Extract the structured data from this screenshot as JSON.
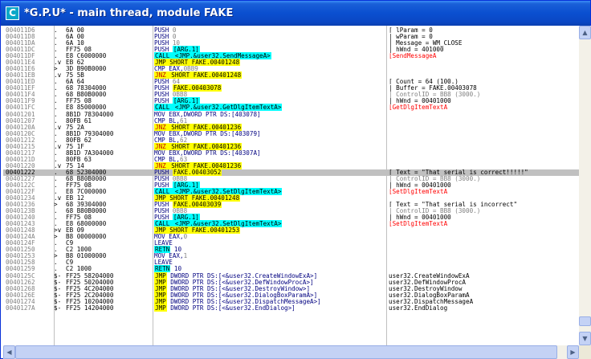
{
  "window": {
    "title": "*G.P.U* - main thread, module FAKE",
    "icon_letter": "C"
  },
  "rows": [
    {
      "addr": "004011D6",
      "jmark": ".",
      "hex": "6A 00",
      "dis": [
        {
          "t": "PUSH "
        },
        {
          "t": "0",
          "k": "gray"
        }
      ],
      "com": [
        {
          "t": "⌈ lParam = 0"
        }
      ]
    },
    {
      "addr": "004011D8",
      "jmark": ".",
      "hex": "6A 00",
      "dis": [
        {
          "t": "PUSH "
        },
        {
          "t": "0",
          "k": "gray"
        }
      ],
      "com": [
        {
          "t": "| wParam = 0"
        }
      ]
    },
    {
      "addr": "004011DA",
      "jmark": ".",
      "hex": "6A 10",
      "dis": [
        {
          "t": "PUSH "
        },
        {
          "t": "10",
          "k": "gray"
        }
      ],
      "com": [
        {
          "t": "| Message = WM_CLOSE"
        }
      ]
    },
    {
      "addr": "004011DC",
      "jmark": ".",
      "hex": "FF75 08",
      "dis": [
        {
          "t": "PUSH "
        },
        {
          "t": "[ARG.1]",
          "k": "arg"
        }
      ],
      "com": [
        {
          "t": "| hWnd = 401000"
        }
      ]
    },
    {
      "addr": "004011DF",
      "jmark": ".",
      "hex": "E8 C6000000",
      "dis": [
        {
          "t": "CALL",
          "k": "call"
        },
        {
          "t": " <JMP.&user32.SendMessageA>",
          "k": "call"
        }
      ],
      "com": [
        {
          "t": "⌊SendMessageA",
          "k": "red"
        }
      ]
    },
    {
      "addr": "004011E4",
      "jmark": ".v",
      "hex": "EB 62",
      "dis": [
        {
          "t": "JMP SHORT FAKE.00401248",
          "k": "jmp"
        }
      ],
      "com": []
    },
    {
      "addr": "004011E6",
      "jmark": ">",
      "hex": "3D B90B0000",
      "dis": [
        {
          "t": "CMP EAX,"
        },
        {
          "t": "0BB9",
          "k": "gray"
        }
      ],
      "com": []
    },
    {
      "addr": "004011EB",
      "jmark": ".v",
      "hex": "75 5B",
      "dis": [
        {
          "t": "JNZ",
          "k": "jcc"
        },
        {
          "t": " SHORT FAKE.00401248",
          "k": "jmp"
        }
      ],
      "com": []
    },
    {
      "addr": "004011ED",
      "jmark": ".",
      "hex": "6A 64",
      "dis": [
        {
          "t": "PUSH "
        },
        {
          "t": "64",
          "k": "gray"
        }
      ],
      "com": [
        {
          "t": "⌈ Count = 64 (100.)"
        }
      ]
    },
    {
      "addr": "004011EF",
      "jmark": ".",
      "hex": "68 78304000",
      "dis": [
        {
          "t": "PUSH "
        },
        {
          "t": "FAKE.00403078",
          "k": "jmp"
        }
      ],
      "com": [
        {
          "t": "| Buffer = FAKE.00403078"
        }
      ]
    },
    {
      "addr": "004011F4",
      "jmark": ".",
      "hex": "68 B80B0000",
      "dis": [
        {
          "t": "PUSH "
        },
        {
          "t": "0BB8",
          "k": "gray"
        }
      ],
      "com": [
        {
          "t": "| ControlID = BB8 (3000.)",
          "k": "gray"
        }
      ]
    },
    {
      "addr": "004011F9",
      "jmark": ".",
      "hex": "FF75 08",
      "dis": [
        {
          "t": "PUSH "
        },
        {
          "t": "[ARG.1]",
          "k": "arg"
        }
      ],
      "com": [
        {
          "t": "| hWnd = 00401000"
        }
      ]
    },
    {
      "addr": "004011FC",
      "jmark": ".",
      "hex": "E8 85000000",
      "dis": [
        {
          "t": "CALL",
          "k": "call"
        },
        {
          "t": " <JMP.&user32.GetDlgItemTextA>",
          "k": "call"
        }
      ],
      "com": [
        {
          "t": "⌊GetDlgItemTextA",
          "k": "red"
        }
      ]
    },
    {
      "addr": "00401201",
      "jmark": ".",
      "hex": "8B1D 78304000",
      "dis": [
        {
          "t": "MOV EBX,DWORD PTR DS:[403078]"
        }
      ],
      "com": []
    },
    {
      "addr": "00401207",
      "jmark": ".",
      "hex": "80FB 61",
      "dis": [
        {
          "t": "CMP BL,"
        },
        {
          "t": "61",
          "k": "gray"
        }
      ],
      "com": []
    },
    {
      "addr": "0040120A",
      "jmark": ".v",
      "hex": "75 2A",
      "dis": [
        {
          "t": "JNZ",
          "k": "jcc"
        },
        {
          "t": " SHORT FAKE.00401236",
          "k": "jmp"
        }
      ],
      "com": []
    },
    {
      "addr": "0040120C",
      "jmark": ".",
      "hex": "8B1D 79304000",
      "dis": [
        {
          "t": "MOV EBX,DWORD PTR DS:[403079]"
        }
      ],
      "com": []
    },
    {
      "addr": "00401212",
      "jmark": ".",
      "hex": "80FB 62",
      "dis": [
        {
          "t": "CMP BL,"
        },
        {
          "t": "62",
          "k": "gray"
        }
      ],
      "com": []
    },
    {
      "addr": "00401215",
      "jmark": ".v",
      "hex": "75 1F",
      "dis": [
        {
          "t": "JNZ",
          "k": "jcc"
        },
        {
          "t": " SHORT FAKE.00401236",
          "k": "jmp"
        }
      ],
      "com": []
    },
    {
      "addr": "00401217",
      "jmark": ".",
      "hex": "8B1D 7A304000",
      "dis": [
        {
          "t": "MOV EBX,DWORD PTR DS:[40307A]"
        }
      ],
      "com": []
    },
    {
      "addr": "0040121D",
      "jmark": ".",
      "hex": "80FB 63",
      "dis": [
        {
          "t": "CMP BL,"
        },
        {
          "t": "63",
          "k": "gray"
        }
      ],
      "com": []
    },
    {
      "addr": "00401220",
      "jmark": ".v",
      "hex": "75 14",
      "dis": [
        {
          "t": "JNZ",
          "k": "jcc"
        },
        {
          "t": " SHORT FAKE.00401236",
          "k": "jmp"
        }
      ],
      "com": []
    },
    {
      "addr": "00401222",
      "jmark": ".",
      "hex": "68 52304000",
      "dis": [
        {
          "t": "PUSH "
        },
        {
          "t": "FAKE.00403052",
          "k": "jmp"
        }
      ],
      "com": [
        {
          "t": "⌈ Text = \"That serial is correct!!!!!\""
        }
      ],
      "sel": true
    },
    {
      "addr": "00401227",
      "jmark": ".",
      "hex": "68 B80B0000",
      "dis": [
        {
          "t": "PUSH "
        },
        {
          "t": "0BB8",
          "k": "gray"
        }
      ],
      "com": [
        {
          "t": "| ControlID = BB8 (3000.)",
          "k": "gray"
        }
      ]
    },
    {
      "addr": "0040122C",
      "jmark": ".",
      "hex": "FF75 08",
      "dis": [
        {
          "t": "PUSH "
        },
        {
          "t": "[ARG.1]",
          "k": "arg"
        }
      ],
      "com": [
        {
          "t": "| hWnd = 00401000"
        }
      ]
    },
    {
      "addr": "0040122F",
      "jmark": ".",
      "hex": "E8 7C000000",
      "dis": [
        {
          "t": "CALL",
          "k": "call"
        },
        {
          "t": " <JMP.&user32.SetDlgItemTextA>",
          "k": "call"
        }
      ],
      "com": [
        {
          "t": "⌊SetDlgItemTextA",
          "k": "red"
        }
      ]
    },
    {
      "addr": "00401234",
      "jmark": ".v",
      "hex": "EB 12",
      "dis": [
        {
          "t": "JMP SHORT FAKE.00401248",
          "k": "jmp"
        }
      ],
      "com": []
    },
    {
      "addr": "00401236",
      "jmark": ">",
      "hex": "68 39304000",
      "dis": [
        {
          "t": "PUSH "
        },
        {
          "t": "FAKE.00403039",
          "k": "jmp"
        }
      ],
      "com": [
        {
          "t": "⌈ Text = \"That serial is incorrect\""
        }
      ]
    },
    {
      "addr": "0040123B",
      "jmark": ".",
      "hex": "68 B80B0000",
      "dis": [
        {
          "t": "PUSH "
        },
        {
          "t": "0BB8",
          "k": "gray"
        }
      ],
      "com": [
        {
          "t": "| ControlID = BB8 (3000.)",
          "k": "gray"
        }
      ]
    },
    {
      "addr": "00401240",
      "jmark": ".",
      "hex": "FF75 08",
      "dis": [
        {
          "t": "PUSH "
        },
        {
          "t": "[ARG.1]",
          "k": "arg"
        }
      ],
      "com": [
        {
          "t": "| hWnd = 00401000"
        }
      ]
    },
    {
      "addr": "00401243",
      "jmark": ".",
      "hex": "E8 68000000",
      "dis": [
        {
          "t": "CALL",
          "k": "call"
        },
        {
          "t": " <JMP.&user32.SetDlgItemTextA>",
          "k": "call"
        }
      ],
      "com": [
        {
          "t": "⌊SetDlgItemTextA",
          "k": "red"
        }
      ]
    },
    {
      "addr": "00401248",
      "jmark": ">v",
      "hex": "EB 09",
      "dis": [
        {
          "t": "JMP SHORT FAKE.00401253",
          "k": "jmp"
        }
      ],
      "com": []
    },
    {
      "addr": "0040124A",
      "jmark": ">",
      "hex": "B8 00000000",
      "dis": [
        {
          "t": "MOV EAX,"
        },
        {
          "t": "0",
          "k": "gray"
        }
      ],
      "com": []
    },
    {
      "addr": "0040124F",
      "jmark": ".",
      "hex": "C9",
      "dis": [
        {
          "t": "LEAVE"
        }
      ],
      "com": []
    },
    {
      "addr": "00401250",
      "jmark": ".",
      "hex": "C2 1000",
      "dis": [
        {
          "t": "RETN",
          "k": "retn"
        },
        {
          "t": " 10"
        }
      ],
      "com": []
    },
    {
      "addr": "00401253",
      "jmark": ">",
      "hex": "B8 01000000",
      "dis": [
        {
          "t": "MOV EAX,"
        },
        {
          "t": "1",
          "k": "gray"
        }
      ],
      "com": []
    },
    {
      "addr": "00401258",
      "jmark": ".",
      "hex": "C9",
      "dis": [
        {
          "t": "LEAVE"
        }
      ],
      "com": []
    },
    {
      "addr": "00401259",
      "jmark": ".",
      "hex": "C2 1000",
      "dis": [
        {
          "t": "RETN",
          "k": "retn"
        },
        {
          "t": " 10"
        }
      ],
      "com": []
    },
    {
      "addr": "0040125C",
      "jmark": "$-",
      "hex": "FF25 58204000",
      "dis": [
        {
          "t": "JMP",
          "k": "jmp"
        },
        {
          "t": " DWORD PTR DS:[<&user32.CreateWindowExA>]"
        }
      ],
      "com": [
        {
          "t": "user32.CreateWindowExA"
        }
      ]
    },
    {
      "addr": "00401262",
      "jmark": "$-",
      "hex": "FF25 50204000",
      "dis": [
        {
          "t": "JMP",
          "k": "jmp"
        },
        {
          "t": " DWORD PTR DS:[<&user32.DefWindowProcA>]"
        }
      ],
      "com": [
        {
          "t": "user32.DefWindowProcA"
        }
      ]
    },
    {
      "addr": "00401268",
      "jmark": "$-",
      "hex": "FF25 4C204000",
      "dis": [
        {
          "t": "JMP",
          "k": "jmp"
        },
        {
          "t": " DWORD PTR DS:[<&user32.DestroyWindow>]"
        }
      ],
      "com": [
        {
          "t": "user32.DestroyWindow"
        }
      ]
    },
    {
      "addr": "0040126E",
      "jmark": "$-",
      "hex": "FF25 2C204000",
      "dis": [
        {
          "t": "JMP",
          "k": "jmp"
        },
        {
          "t": " DWORD PTR DS:[<&user32.DialogBoxParamA>]"
        }
      ],
      "com": [
        {
          "t": "user32.DialogBoxParamA"
        }
      ]
    },
    {
      "addr": "00401274",
      "jmark": "$-",
      "hex": "FF25 10204000",
      "dis": [
        {
          "t": "JMP",
          "k": "jmp"
        },
        {
          "t": " DWORD PTR DS:[<&user32.DispatchMessageA>]"
        }
      ],
      "com": [
        {
          "t": "user32.DispatchMessageA"
        }
      ]
    },
    {
      "addr": "0040127A",
      "jmark": "$-",
      "hex": "FF25 14204000",
      "dis": [
        {
          "t": "JMP",
          "k": "jmp"
        },
        {
          "t": " DWORD PTR DS:[<&user32.EndDialog>]"
        }
      ],
      "com": [
        {
          "t": "user32.EndDialog"
        }
      ]
    }
  ],
  "scrollbars": {
    "vertical_position": 0.98,
    "horizontal_position": 0.0,
    "up_arrow": "▲",
    "down_arrow": "▼",
    "left_arrow": "◀",
    "right_arrow": "▶"
  },
  "colors": {
    "title_bar": "#0a4fd0",
    "call_highlight": "#00ffff",
    "jump_highlight": "#ffff00",
    "selected_row": "#c0c0c0",
    "api_comment": "#ff0000"
  }
}
